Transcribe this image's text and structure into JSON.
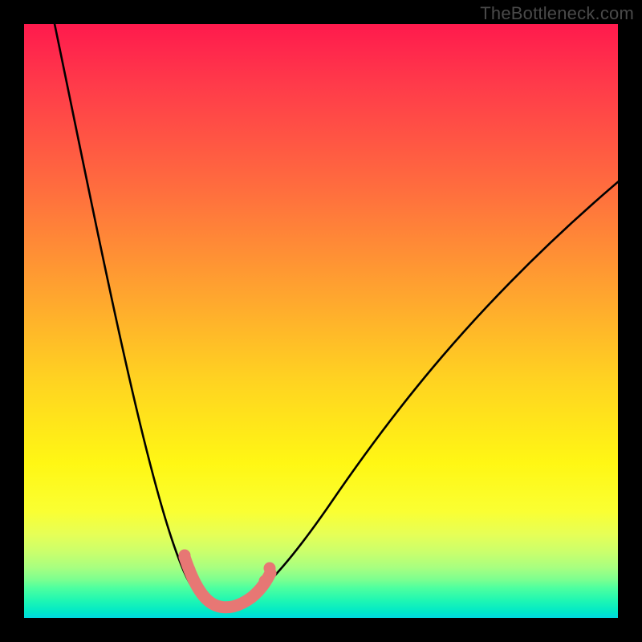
{
  "watermark": "TheBottleneck.com",
  "chart_data": {
    "type": "line",
    "title": "",
    "xlabel": "",
    "ylabel": "",
    "xlim": [
      0,
      100
    ],
    "ylim": [
      0,
      100
    ],
    "grid": false,
    "legend": false,
    "annotations": [
      "TheBottleneck.com"
    ],
    "x": [
      5,
      10,
      15,
      20,
      25,
      27,
      30,
      32,
      34,
      36,
      38,
      40,
      45,
      50,
      55,
      60,
      65,
      70,
      75,
      80,
      85,
      90,
      95,
      100
    ],
    "values": [
      100,
      80,
      62,
      45,
      24,
      12,
      4,
      1,
      0,
      1,
      3,
      7,
      15,
      24,
      32,
      40,
      48,
      55,
      61,
      66,
      70,
      73,
      75,
      77
    ],
    "background_gradient": {
      "orientation": "vertical",
      "stops": [
        {
          "pos": 0.0,
          "color": "#ff1a4d"
        },
        {
          "pos": 0.28,
          "color": "#ff6e3e"
        },
        {
          "pos": 0.6,
          "color": "#ffd321"
        },
        {
          "pos": 0.82,
          "color": "#faff32"
        },
        {
          "pos": 0.95,
          "color": "#4cffa0"
        },
        {
          "pos": 1.0,
          "color": "#00d8e0"
        }
      ]
    },
    "marker": {
      "type": "highlight-segment",
      "color": "#e77774",
      "x_range": [
        27,
        41
      ],
      "note": "optimal/valley region"
    }
  }
}
